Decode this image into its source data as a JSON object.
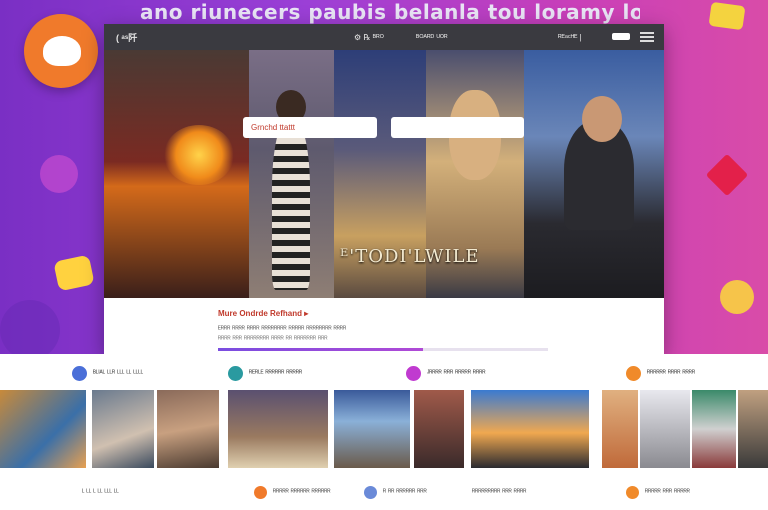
{
  "banner": {
    "title": "ano riunecers paubis belanla tou loramy louurhou."
  },
  "window": {
    "brand": "( ᵃˢ阡",
    "nav": [
      "⚙ ℞ ᴮᴿᴼ",
      "ᴮᴼᴬᴿᴰ ᵁᴼᴿ",
      "ᴿᴱᵃᶜᴴᴱ  |"
    ]
  },
  "hero": {
    "input1_value": "Grnchd ttattt",
    "input2_value": "",
    "caption": "ᴱ'TODI'LWILE"
  },
  "strip": {
    "title": "Mure  Ondrde Refhand  ▸",
    "line1": "ᴱᴿᴿᴿ ᴿᴿᴿᴿ ᴿᴿᴿᴿ ᴿᴿᴿᴿᴿᴿᴿᴿ ᴿᴿᴿᴿᴿ ᴿᴿᴿᴿᴿᴿᴿᴿ ᴿᴿᴿᴿ",
    "line2": "ᴿᴿᴿᴿ ᴿᴿᴿ ᴿᴿᴿᴿᴿᴿᴿᴿ ᴿᴿᴿᴿ ᴿᴿ ᴿᴿᴿᴿᴿᴿᴿ ᴿᴿᴿ",
    "progress": 0.62
  },
  "categories": [
    {
      "label": "ᴮᴸᴵᴬᴸ ᴸᴸᴿ ᴸᴸᴸ ᴸᴸ ᴸᴸᴸᴸ",
      "color": "#4a6fd8"
    },
    {
      "label": "ᴿᴱᴿᴸᴱ ᴿᴿᴿᴿᴿᴿ ᴿᴿᴿᴿᴿ",
      "color": "#2a9aa0"
    },
    {
      "label": "ᴶᴿᴿᴿᴿ ᴿᴿᴿ ᴿᴿᴿᴿᴿ ᴿᴿᴿᴿ",
      "color": "#c03ad0"
    },
    {
      "label": "ᴿᴿᴿᴿᴿᴿ ᴿᴿᴿᴿ ᴿᴿᴿᴿ",
      "color": "#f08a2a"
    }
  ],
  "footer": [
    {
      "label": "ᴸ ᴸᴸ ᴸ ᴸᴸ ᴸᴸᴸ ᴸᴸ",
      "color": ""
    },
    {
      "label": "ᴿᴿᴿᴿᴿ ᴿᴿᴿᴿᴿᴿ ᴿᴿᴿᴿᴿᴿ",
      "color": "#f07a2b"
    },
    {
      "label": "ᴿ ᴿᴿ ᴿᴿᴿᴿᴿᴿ ᴿᴿᴿ",
      "color": "#6a8ad8"
    },
    {
      "label": "ᴿᴿᴿᴿᴿᴿᴿᴿᴿ ᴿᴿᴿ ᴿᴿᴿᴿ",
      "color": ""
    },
    {
      "label": "ᴿᴿᴿᴿᴿ ᴿᴿᴿ ᴿᴿᴿᴿᴿ",
      "color": "#f08a2a"
    }
  ],
  "colors": {
    "brand_orange": "#f07a2b",
    "accent_purple": "#9b3fd6",
    "accent_pink": "#d94ca8"
  },
  "icons": [
    "logo-icon",
    "hamburger-menu-icon",
    "category-dot-icon"
  ]
}
